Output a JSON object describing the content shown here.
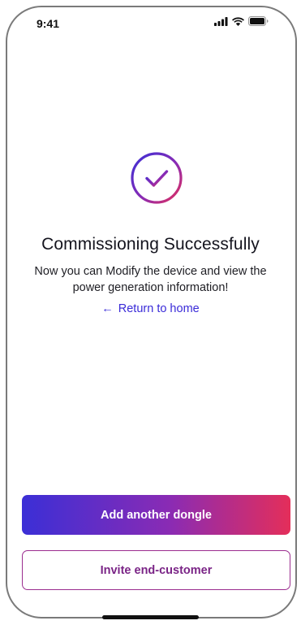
{
  "status_bar": {
    "time": "9:41",
    "icons": [
      "cellular-signal-icon",
      "wifi-icon",
      "battery-icon"
    ]
  },
  "main": {
    "icon": "check-circle-icon",
    "title": "Commissioning Successfully",
    "subtitle": "Now you can Modify the device and view the power generation information!",
    "return_link": {
      "arrow": "←",
      "label": "Return to home"
    }
  },
  "actions": {
    "primary_label": "Add another dongle",
    "secondary_label": "Invite end-customer"
  },
  "colors": {
    "gradient_start": "#3b2fd6",
    "gradient_mid": "#8a2bb4",
    "gradient_end": "#e42e5a",
    "link": "#3a2bd8",
    "secondary_border": "#9b2d8f",
    "secondary_text": "#7a2486"
  }
}
